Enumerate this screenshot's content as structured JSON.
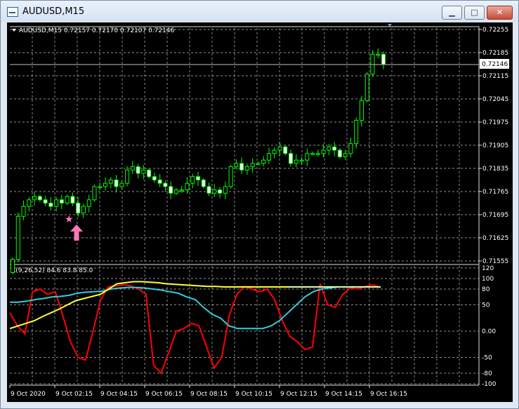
{
  "window": {
    "title": "AUDUSD,M15",
    "buttons": {
      "minimize": "▁",
      "maximize": "□",
      "close": "✕"
    }
  },
  "main_chart": {
    "header": "AUDUSD,M15  0.72157 0.72170 0.72107 0.72146",
    "price_labels": [
      "0.72255",
      "0.72185",
      "0.72115",
      "0.72045",
      "0.71975",
      "0.71905",
      "0.71835",
      "0.71765",
      "0.71695",
      "0.71625",
      "0.71555"
    ],
    "current_price": "0.72146"
  },
  "indicator": {
    "header": "R(9,26,52) 84.6 83.8 85.0",
    "scale_labels": [
      "120",
      "100",
      "80",
      "50",
      "0.00",
      "-50",
      "-80",
      "-100"
    ]
  },
  "time_labels": [
    "9 Oct 2020",
    "9 Oct 02:15",
    "9 Oct 04:15",
    "9 Oct 06:15",
    "9 Oct 08:15",
    "9 Oct 10:15",
    "9 Oct 12:15",
    "9 Oct 14:15",
    "9 Oct 16:15"
  ],
  "colors": {
    "background": "#000000",
    "candle": "#00ff00",
    "grid": "#c0c0c0",
    "series_red": "#ff0000",
    "series_cyan": "#33ccdd",
    "series_yellow": "#ffff33",
    "series_pale": "#d9ffb0",
    "marker": "#ff77bb"
  },
  "markers": {
    "star": "★",
    "arrow": "up-arrow-icon"
  },
  "chart_data": [
    {
      "type": "candlestick",
      "title": "AUDUSD,M15",
      "ylim": [
        0.71555,
        0.72255
      ],
      "current_price": 0.72146,
      "x": [
        "9 Oct 2020",
        "9 Oct 02:15",
        "9 Oct 04:15",
        "9 Oct 06:15",
        "9 Oct 08:15",
        "9 Oct 10:15",
        "9 Oct 12:15",
        "9 Oct 14:15",
        "9 Oct 16:15"
      ],
      "closes": [
        0.7156,
        0.7169,
        0.7172,
        0.7174,
        0.7175,
        0.7174,
        0.7173,
        0.7172,
        0.7174,
        0.7173,
        0.7175,
        0.7173,
        0.717,
        0.7172,
        0.7174,
        0.7178,
        0.7178,
        0.7179,
        0.718,
        0.7178,
        0.7179,
        0.7183,
        0.7184,
        0.7182,
        0.7183,
        0.7181,
        0.718,
        0.7179,
        0.7178,
        0.7176,
        0.7177,
        0.7177,
        0.7179,
        0.7181,
        0.718,
        0.7178,
        0.7176,
        0.7177,
        0.7176,
        0.7178,
        0.7184,
        0.7185,
        0.7183,
        0.7184,
        0.7185,
        0.7185,
        0.7186,
        0.7188,
        0.7189,
        0.719,
        0.7188,
        0.7185,
        0.7186,
        0.7186,
        0.7188,
        0.7188,
        0.7188,
        0.7189,
        0.719,
        0.7189,
        0.7187,
        0.7188,
        0.7191,
        0.7198,
        0.7204,
        0.7212,
        0.7218,
        0.7218,
        0.7215
      ]
    },
    {
      "type": "line",
      "title": "R(9,26,52)",
      "ylim": [
        -100,
        120
      ],
      "current": [
        84.6,
        83.8,
        85.0
      ],
      "series": [
        {
          "color": "#ff0000",
          "values": [
            35,
            10,
            -5,
            75,
            80,
            70,
            75,
            30,
            -20,
            -50,
            -55,
            0,
            60,
            84,
            86,
            88,
            86,
            80,
            70,
            -65,
            -80,
            -40,
            0,
            5,
            15,
            10,
            -30,
            -70,
            -50,
            30,
            70,
            85,
            80,
            75,
            80,
            60,
            20,
            -10,
            -20,
            -35,
            -30,
            90,
            50,
            45,
            70,
            82,
            80,
            85,
            88,
            83
          ]
        },
        {
          "color": "#33ccdd",
          "values": [
            55,
            55,
            57,
            60,
            62,
            65,
            66,
            68,
            72,
            74,
            75,
            76,
            80,
            82,
            83,
            83,
            82,
            80,
            78,
            75,
            72,
            65,
            60,
            45,
            32,
            25,
            10,
            5,
            5,
            5,
            5,
            10,
            20,
            35,
            50,
            65,
            75,
            80,
            82,
            84,
            84,
            84,
            84,
            84,
            84
          ]
        },
        {
          "color": "#ffff33",
          "values": [
            5,
            10,
            15,
            20,
            28,
            35,
            42,
            50,
            58,
            62,
            66,
            70,
            80,
            90,
            92,
            94,
            94,
            93,
            92,
            90,
            89,
            88,
            87,
            86,
            85,
            85,
            84,
            84,
            84,
            84,
            84,
            84,
            84,
            84,
            84,
            84,
            84,
            84,
            84,
            84,
            84,
            84,
            84,
            84,
            84,
            84
          ]
        },
        {
          "color": "#d9ffb0",
          "values": [
            84,
            84,
            84,
            84,
            84,
            84,
            84,
            84,
            84,
            84,
            84,
            84,
            84,
            84,
            84,
            84,
            84,
            84,
            84,
            84
          ]
        }
      ]
    }
  ]
}
